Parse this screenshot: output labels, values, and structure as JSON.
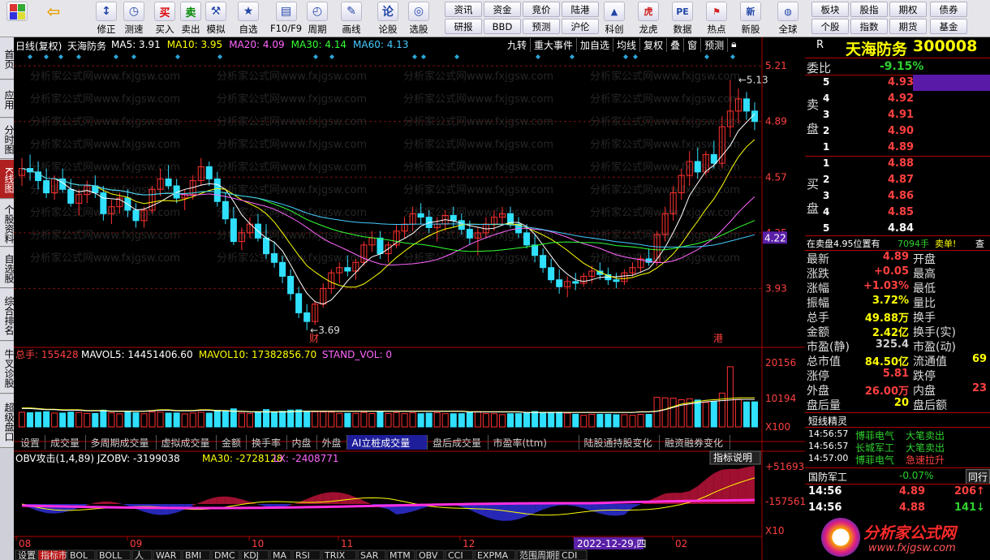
{
  "toolbar": {
    "buttons": [
      {
        "icon": "grid-icon",
        "label": ""
      },
      {
        "icon": "back-arrow-icon",
        "label": ""
      },
      {
        "icon": "fix-icon",
        "label": "修正"
      },
      {
        "icon": "clock-icon",
        "label": "测速"
      },
      {
        "icon": "buy-icon",
        "glyph": "买",
        "label": "买入"
      },
      {
        "icon": "sell-icon",
        "glyph": "卖",
        "label": "卖出"
      },
      {
        "icon": "hammer-icon",
        "label": "模拟"
      },
      {
        "icon": "star-icon",
        "label": "自选"
      },
      {
        "icon": "f10-icon",
        "label": "F10/F9"
      },
      {
        "icon": "cycle-icon",
        "label": "周期"
      },
      {
        "icon": "pen-icon",
        "label": "画线"
      },
      {
        "icon": "comment-icon",
        "label": "论股"
      },
      {
        "icon": "select-icon",
        "label": "选股"
      }
    ],
    "small_buttons": [
      [
        "资讯",
        "研报"
      ],
      [
        "资金",
        "BBD"
      ],
      [
        "竞价",
        "预测"
      ],
      [
        "陆港",
        "沪伦"
      ]
    ],
    "buttons2": [
      {
        "icon": "chart-icon",
        "label": "科创"
      },
      {
        "icon": "tiger-icon",
        "label": "龙虎"
      },
      {
        "icon": "pe-icon",
        "label": "数据"
      },
      {
        "icon": "hot-icon",
        "label": "热点"
      },
      {
        "icon": "new-icon",
        "label": "新股"
      },
      {
        "icon": "globe-icon",
        "label": "全球"
      }
    ],
    "small_buttons2": [
      [
        "板块",
        "个股"
      ],
      [
        "股指",
        "指数"
      ],
      [
        "期权",
        "期货"
      ],
      [
        "债券",
        "基金"
      ]
    ]
  },
  "left_tabs": [
    "首页",
    "应用",
    "分时图",
    "K线图",
    "个股资料",
    "自选股",
    "综合排名",
    "牛叉诊股",
    "超级盘口"
  ],
  "chart": {
    "period": "日线(复权)",
    "name": "天海防务",
    "ma": [
      {
        "label": "MA5: 3.91",
        "color": "#ffffff"
      },
      {
        "label": "MA10: 3.95",
        "color": "#ffff00"
      },
      {
        "label": "MA20: 4.09",
        "color": "#ff66ff"
      },
      {
        "label": "MA30: 4.14",
        "color": "#33ff33"
      },
      {
        "label": "MA60: 4.13",
        "color": "#44ccff"
      }
    ],
    "tools": [
      "九转",
      "重大事件",
      "加自选",
      "均线",
      "复权",
      "叠",
      "窗",
      "预测"
    ],
    "price_axis": [
      "5.21",
      "4.89",
      "4.57",
      "4.25",
      "4.22",
      "3.93"
    ],
    "high_label": "5.13",
    "low_label": "3.69",
    "event1": "财",
    "event2": "港",
    "vol_header": [
      "总手: 155428",
      "MAVOL5: 14451406.60",
      "MAVOL10: 17382856.70",
      "STAND_VOL: 0"
    ],
    "vol_axis": [
      "20156",
      "10194",
      "X100"
    ],
    "obv_header": [
      "OBV攻击(1,4,89) JZOBV: -3199038",
      "MA30: -2728128",
      "LX: -2408771"
    ],
    "obv_axis": [
      "+51693",
      "-157561",
      "X10"
    ],
    "obv_button": "指标说明",
    "months": [
      "08",
      "09",
      "10",
      "11",
      "12",
      "01",
      "02"
    ],
    "date_marker": "2022-12-29,四",
    "sub_tabs": [
      "设置",
      "成交量",
      "多周期成交量",
      "虚拟成交量",
      "金额",
      "换手率",
      "内盘",
      "外盘",
      "AI立桩成交量",
      "盘后成交量",
      "市盈率(ttm)",
      "陆股通持股变化",
      "融资融券变化"
    ],
    "active_subtab": "AI立桩成交量",
    "bottom_tabs": [
      "设置",
      "指标市",
      "BOL",
      "BOLL",
      "人",
      "WAR",
      "BMI",
      "DMC",
      "KDJ",
      "MA",
      "RSI",
      "TRIX",
      "SAR",
      "MTM",
      "OBV",
      "CCI",
      "EXPMA",
      "范围周期图",
      "CDI"
    ],
    "watermark": "分析家公式网www.fxjgsw.com",
    "grid_prices": [
      5.21,
      4.89,
      4.57,
      4.25,
      3.93
    ],
    "y_range": [
      3.61,
      5.29
    ]
  },
  "quote": {
    "code": "R",
    "name": "天海防务",
    "number": "300008",
    "weibi_label": "委比",
    "weibi": "-9.15%",
    "sell_label": [
      "卖",
      "盘"
    ],
    "sells": [
      [
        "5",
        "4.93"
      ],
      [
        "4",
        "4.92"
      ],
      [
        "3",
        "4.91"
      ],
      [
        "2",
        "4.90"
      ],
      [
        "1",
        "4.89"
      ]
    ],
    "buy_label": [
      "买",
      "盘"
    ],
    "buys": [
      [
        "1",
        "4.88"
      ],
      [
        "2",
        "4.87"
      ],
      [
        "3",
        "4.86"
      ],
      [
        "4",
        "4.85"
      ],
      [
        "5",
        "4.84"
      ]
    ],
    "notice_a": "在卖盘4.95位置有",
    "notice_b": "7094手",
    "notice_c": "卖单!",
    "notice_d": "查",
    "stats": [
      [
        "最新",
        "4.89",
        "red",
        "开盘",
        ""
      ],
      [
        "涨跌",
        "+0.05",
        "red",
        "最高",
        ""
      ],
      [
        "涨幅",
        "+1.03%",
        "red",
        "最低",
        ""
      ],
      [
        "振幅",
        "3.72%",
        "yel",
        "量比",
        ""
      ],
      [
        "总手",
        "49.88万",
        "yel",
        "换手",
        ""
      ],
      [
        "金额",
        "2.42亿",
        "yel",
        "换手(实)",
        ""
      ],
      [
        "市盈(静)",
        "325.4",
        "gry",
        "市盈(动)",
        ""
      ],
      [
        "总市值",
        "84.50亿",
        "yel",
        "流通值",
        "69"
      ],
      [
        "涨停",
        "5.81",
        "red",
        "跌停",
        ""
      ],
      [
        "外盘",
        "26.00万",
        "red",
        "内盘",
        "23"
      ],
      [
        "盘后量",
        "20",
        "yel",
        "盘后额",
        ""
      ]
    ],
    "short_title": "短线精灵",
    "short_list": [
      [
        "14:56:57",
        "博菲电气",
        "大笔卖出"
      ],
      [
        "14:56:57",
        "长城军工",
        "大笔卖出"
      ],
      [
        "14:57:00",
        "博菲电气",
        "急速拉升"
      ]
    ],
    "sector_name": "国防军工",
    "sector_pct": "-0.07%",
    "sector_btn": "同行",
    "ticks": [
      [
        "14:56",
        "4.89",
        "206",
        "↑"
      ],
      [
        "14:56",
        "4.88",
        "141",
        "↓"
      ]
    ],
    "logo_text": "分析家公式网",
    "logo_url": "www.fxjgsw.com"
  },
  "chart_data": {
    "type": "candlestick",
    "ohlc": [
      [
        4.58,
        4.68,
        4.52,
        4.62
      ],
      [
        4.62,
        4.7,
        4.55,
        4.6
      ],
      [
        4.6,
        4.66,
        4.5,
        4.55
      ],
      [
        4.55,
        4.62,
        4.45,
        4.48
      ],
      [
        4.48,
        4.58,
        4.44,
        4.56
      ],
      [
        4.56,
        4.62,
        4.48,
        4.5
      ],
      [
        4.5,
        4.56,
        4.4,
        4.42
      ],
      [
        4.42,
        4.5,
        4.35,
        4.47
      ],
      [
        4.47,
        4.55,
        4.42,
        4.52
      ],
      [
        4.52,
        4.58,
        4.45,
        4.48
      ],
      [
        4.48,
        4.52,
        4.32,
        4.36
      ],
      [
        4.36,
        4.44,
        4.3,
        4.4
      ],
      [
        4.4,
        4.48,
        4.36,
        4.45
      ],
      [
        4.45,
        4.5,
        4.34,
        4.38
      ],
      [
        4.38,
        4.42,
        4.28,
        4.32
      ],
      [
        4.32,
        4.4,
        4.28,
        4.38
      ],
      [
        4.38,
        4.52,
        4.36,
        4.5
      ],
      [
        4.5,
        4.62,
        4.46,
        4.56
      ],
      [
        4.56,
        4.64,
        4.5,
        4.52
      ],
      [
        4.52,
        4.56,
        4.42,
        4.45
      ],
      [
        4.45,
        4.5,
        4.38,
        4.47
      ],
      [
        4.47,
        4.58,
        4.44,
        4.55
      ],
      [
        4.55,
        4.68,
        4.52,
        4.63
      ],
      [
        4.63,
        4.66,
        4.52,
        4.56
      ],
      [
        4.56,
        4.6,
        4.4,
        4.43
      ],
      [
        4.43,
        4.48,
        4.3,
        4.33
      ],
      [
        4.33,
        4.4,
        4.18,
        4.2
      ],
      [
        4.2,
        4.28,
        4.15,
        4.25
      ],
      [
        4.25,
        4.34,
        4.22,
        4.3
      ],
      [
        4.3,
        4.36,
        4.2,
        4.22
      ],
      [
        4.22,
        4.3,
        4.1,
        4.13
      ],
      [
        4.13,
        4.2,
        4.05,
        4.08
      ],
      [
        4.08,
        4.12,
        3.96,
        4.0
      ],
      [
        4.0,
        4.04,
        3.86,
        3.9
      ],
      [
        3.9,
        3.94,
        3.76,
        3.79
      ],
      [
        3.79,
        3.84,
        3.69,
        3.74
      ],
      [
        3.74,
        3.86,
        3.72,
        3.84
      ],
      [
        3.84,
        3.96,
        3.82,
        3.93
      ],
      [
        3.93,
        4.04,
        3.9,
        4.02
      ],
      [
        4.02,
        4.08,
        3.96,
        4.05
      ],
      [
        4.05,
        4.12,
        4.0,
        4.03
      ],
      [
        4.03,
        4.1,
        3.98,
        4.08
      ],
      [
        4.08,
        4.2,
        4.06,
        4.18
      ],
      [
        4.18,
        4.26,
        4.14,
        4.22
      ],
      [
        4.22,
        4.26,
        4.1,
        4.13
      ],
      [
        4.13,
        4.2,
        4.08,
        4.18
      ],
      [
        4.18,
        4.3,
        4.16,
        4.26
      ],
      [
        4.26,
        4.34,
        4.22,
        4.3
      ],
      [
        4.3,
        4.4,
        4.26,
        4.36
      ],
      [
        4.36,
        4.42,
        4.3,
        4.34
      ],
      [
        4.34,
        4.38,
        4.25,
        4.28
      ],
      [
        4.28,
        4.34,
        4.2,
        4.3
      ],
      [
        4.3,
        4.38,
        4.26,
        4.35
      ],
      [
        4.35,
        4.4,
        4.28,
        4.32
      ],
      [
        4.32,
        4.36,
        4.24,
        4.27
      ],
      [
        4.27,
        4.32,
        4.18,
        4.22
      ],
      [
        4.22,
        4.28,
        4.12,
        4.25
      ],
      [
        4.25,
        4.34,
        4.22,
        4.3
      ],
      [
        4.3,
        4.38,
        4.26,
        4.34
      ],
      [
        4.34,
        4.4,
        4.3,
        4.36
      ],
      [
        4.36,
        4.4,
        4.28,
        4.3
      ],
      [
        4.3,
        4.34,
        4.22,
        4.25
      ],
      [
        4.25,
        4.3,
        4.16,
        4.18
      ],
      [
        4.18,
        4.24,
        4.08,
        4.12
      ],
      [
        4.12,
        4.16,
        4.02,
        4.05
      ],
      [
        4.05,
        4.1,
        3.96,
        3.98
      ],
      [
        3.98,
        4.04,
        3.9,
        3.94
      ],
      [
        3.94,
        4.0,
        3.88,
        3.97
      ],
      [
        3.97,
        4.02,
        3.92,
        3.96
      ],
      [
        3.96,
        4.02,
        3.94,
        4.0
      ],
      [
        4.0,
        4.06,
        3.96,
        4.03
      ],
      [
        4.03,
        4.08,
        3.98,
        4.01
      ],
      [
        4.01,
        4.05,
        3.95,
        3.98
      ],
      [
        3.98,
        4.02,
        3.93,
        3.97
      ],
      [
        3.97,
        4.04,
        3.95,
        4.02
      ],
      [
        4.02,
        4.08,
        4.0,
        4.05
      ],
      [
        4.05,
        4.12,
        4.02,
        4.1
      ],
      [
        4.1,
        4.16,
        4.06,
        4.08
      ],
      [
        4.08,
        4.26,
        4.06,
        4.24
      ],
      [
        4.24,
        4.4,
        4.2,
        4.36
      ],
      [
        4.36,
        4.52,
        4.32,
        4.48
      ],
      [
        4.48,
        4.62,
        4.44,
        4.58
      ],
      [
        4.58,
        4.72,
        4.52,
        4.66
      ],
      [
        4.66,
        4.74,
        4.56,
        4.6
      ],
      [
        4.6,
        4.72,
        4.58,
        4.7
      ],
      [
        4.7,
        4.78,
        4.62,
        4.65
      ],
      [
        4.65,
        4.92,
        4.62,
        4.86
      ],
      [
        4.86,
        5.13,
        4.8,
        4.95
      ],
      [
        4.95,
        5.08,
        4.88,
        5.02
      ],
      [
        5.02,
        5.06,
        4.9,
        4.95
      ],
      [
        4.95,
        5.0,
        4.84,
        4.89
      ]
    ],
    "vol_line": [
      0.3,
      0.3,
      0.29,
      0.28,
      0.28,
      0.27,
      0.27,
      0.27,
      0.26,
      0.26,
      0.26,
      0.25,
      0.25,
      0.25,
      0.25,
      0.25,
      0.26,
      0.27,
      0.27,
      0.26,
      0.26,
      0.26,
      0.27,
      0.27,
      0.26,
      0.26,
      0.25,
      0.25,
      0.24,
      0.24,
      0.24,
      0.24,
      0.24,
      0.24,
      0.25,
      0.25,
      0.25,
      0.25,
      0.25,
      0.25,
      0.25,
      0.25,
      0.25,
      0.25,
      0.25,
      0.25,
      0.25,
      0.25,
      0.25,
      0.25,
      0.25,
      0.25,
      0.25,
      0.25,
      0.25,
      0.24,
      0.24,
      0.24,
      0.24,
      0.24,
      0.24,
      0.24,
      0.23,
      0.23,
      0.23,
      0.23,
      0.23,
      0.23,
      0.23,
      0.23,
      0.23,
      0.23,
      0.23,
      0.23,
      0.23,
      0.23,
      0.24,
      0.24,
      0.25,
      0.28,
      0.32,
      0.36,
      0.38,
      0.4,
      0.42,
      0.43,
      0.44,
      0.45,
      0.46,
      0.46,
      0.46
    ],
    "ma_series": [
      "MA5",
      "MA10",
      "MA20",
      "MA30",
      "MA60"
    ]
  }
}
